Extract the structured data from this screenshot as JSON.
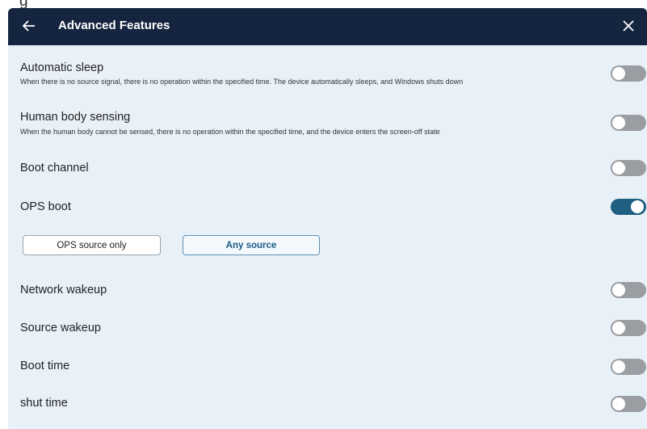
{
  "header": {
    "title": "Advanced Features",
    "back_icon": "arrow-left-icon",
    "close_icon": "close-icon",
    "background": "#15253f"
  },
  "settings": [
    {
      "id": "automatic-sleep",
      "label": "Automatic sleep",
      "description": "When there is no source signal, there is no operation within the specified time. The device automatically sleeps, and Windows shuts down",
      "enabled": false
    },
    {
      "id": "human-body-sensing",
      "label": "Human body sensing",
      "description": "When the human body cannot be sensed, there is no operation within the specified time, and the device enters the screen-off state",
      "enabled": false
    },
    {
      "id": "boot-channel",
      "label": "Boot channel",
      "enabled": false
    },
    {
      "id": "ops-boot",
      "label": "OPS boot",
      "enabled": true
    },
    {
      "id": "network-wakeup",
      "label": "Network wakeup",
      "enabled": false
    },
    {
      "id": "source-wakeup",
      "label": "Source wakeup",
      "enabled": false
    },
    {
      "id": "boot-time",
      "label": "Boot time",
      "enabled": false
    },
    {
      "id": "shut-time",
      "label": "shut time",
      "enabled": false
    }
  ],
  "ops_boot_options": {
    "options": [
      "OPS source only",
      "Any source"
    ],
    "selected": "Any source"
  },
  "colors": {
    "panel_background": "#e9f1f8",
    "toggle_on": "#1f5f82",
    "toggle_off": "#9a9da2",
    "selected_text": "#1a5b86"
  }
}
